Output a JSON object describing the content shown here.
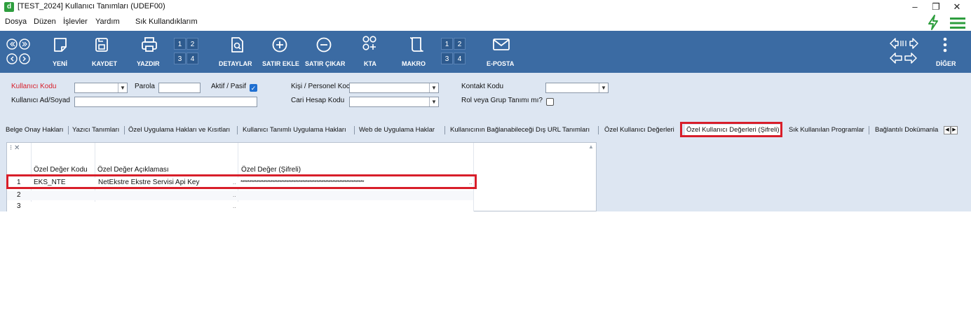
{
  "window": {
    "app_icon": "d",
    "title": "[TEST_2024] Kullanıcı Tanımları  (UDEF00)",
    "controls": [
      "–",
      "❐",
      "✕"
    ]
  },
  "menu": {
    "items": [
      "Dosya",
      "Düzen",
      "İşlevler",
      "Yardım",
      "Sık Kullandıklarım"
    ]
  },
  "toolbar": {
    "buttons": [
      {
        "label": "YENİ",
        "icon": "new-document-icon"
      },
      {
        "label": "KAYDET",
        "icon": "save-icon"
      },
      {
        "label": "YAZDIR",
        "icon": "printer-icon"
      },
      {
        "label": "DETAYLAR",
        "icon": "details-icon"
      },
      {
        "label": "SATIR EKLE",
        "icon": "plus-circle-icon"
      },
      {
        "label": "SATIR ÇIKAR",
        "icon": "minus-circle-icon"
      },
      {
        "label": "KTA",
        "icon": "kta-icon"
      },
      {
        "label": "MAKRO",
        "icon": "scroll-icon"
      },
      {
        "label": "E-POSTA",
        "icon": "mail-icon"
      },
      {
        "label": "DİĞER",
        "icon": "more-vertical-icon"
      }
    ],
    "print_numbers": [
      "1",
      "2",
      "3",
      "4"
    ],
    "macro_numbers": [
      "1",
      "2",
      "3",
      "4"
    ],
    "accent": "#3b6ba3"
  },
  "filter": {
    "user_code_label": "Kullanıcı Kodu",
    "user_name_label": "Kullanıcı Ad/Soyad",
    "password_label": "Parola",
    "active_label": "Aktif / Pasif",
    "person_label": "Kişi / Personel Koc",
    "account_label": "Cari Hesap Kodu",
    "contact_label": "Kontakt Kodu",
    "role_label": "Rol veya Grup Tanımı mı?",
    "active_checked": true,
    "role_checked": false,
    "required_color": "#d81e2a"
  },
  "tabs": [
    "Belge Onay Hakları",
    "Yazıcı Tanımları",
    "Özel Uygulama Hakları ve Kısıtları",
    "Kullanıcı Tanımlı Uygulama Hakları",
    "Web de Uygulama Haklar",
    "Kullanıcının Bağlanabileceği Dış URL Tanımları",
    "Özel Kullanıcı Değerleri",
    "Özel Kullanıcı Değerleri (Şifreli)",
    "Sık Kullanılan Programlar",
    "Bağlantılı Dokümanla"
  ],
  "active_tab": "Özel Kullanıcı Değerleri (Şifreli)",
  "grid": {
    "menu_icon": "⁝ ✕",
    "columns": [
      "Özel Değer Kodu",
      "Özel Değer Açıklaması",
      "Özel Değer (Şifreli)"
    ],
    "rows": [
      {
        "num": "1",
        "code": "EKS_NTE",
        "desc": "NetEkstre Ekstre Servisi Api Key",
        "value": "**********************************************************************"
      },
      {
        "num": "2",
        "code": "",
        "desc": "",
        "value": ""
      },
      {
        "num": "3",
        "code": "",
        "desc": "",
        "value": ""
      }
    ],
    "ellipsis": ".."
  },
  "highlight_color": "#d81e2a"
}
